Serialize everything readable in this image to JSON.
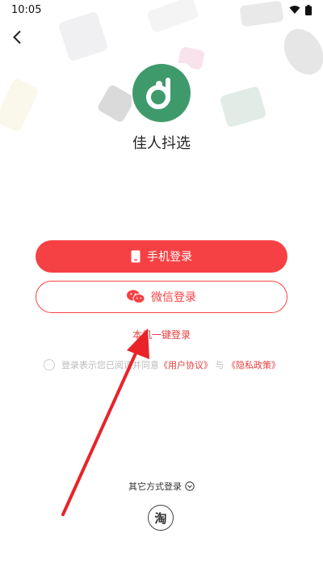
{
  "status_bar": {
    "time": "10:05"
  },
  "app": {
    "name": "佳人抖选",
    "logo_icon": "d-letter-logo-icon",
    "logo_color": "#3f9a6b"
  },
  "buttons": {
    "phone_login": "手机登录",
    "wechat_login": "微信登录",
    "onekey_login": "本机一键登录"
  },
  "agreement": {
    "prefix": "登录表示您已阅读并同意",
    "user_agreement": "《用户协议》",
    "and": "与",
    "privacy_policy": "《隐私政策》"
  },
  "other_login": {
    "label": "其它方式登录",
    "taobao_glyph": "淘"
  },
  "colors": {
    "accent": "#f64144",
    "link": "#e73c3e"
  }
}
